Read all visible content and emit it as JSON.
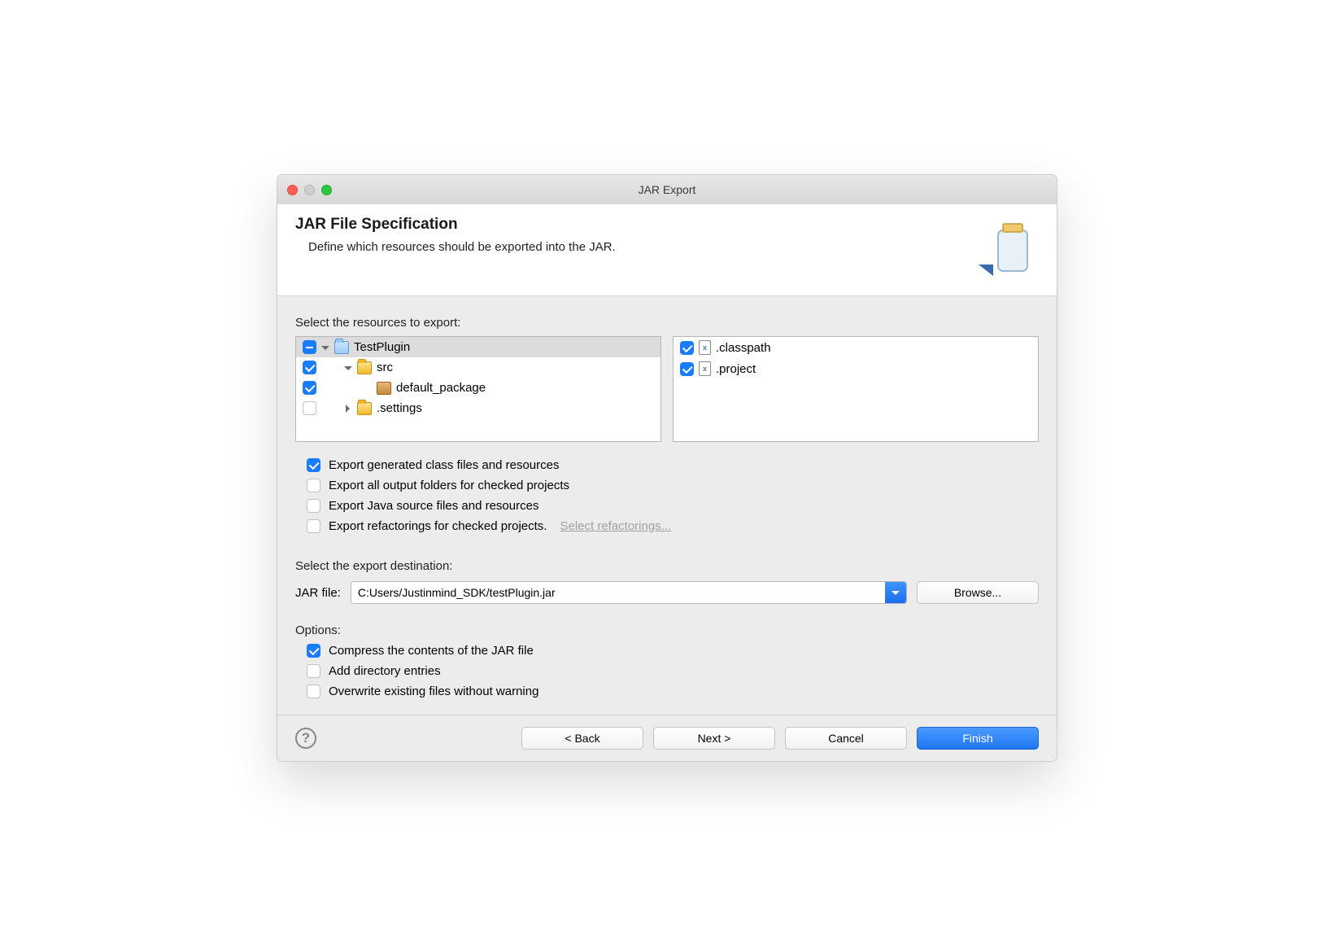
{
  "window": {
    "title": "JAR Export"
  },
  "header": {
    "title": "JAR File Specification",
    "subtitle": "Define which resources should be exported into the JAR."
  },
  "resources": {
    "label": "Select the resources to export:",
    "tree": [
      {
        "name": "TestPlugin",
        "state": "mixed",
        "expand": "down",
        "icon": "proj"
      },
      {
        "name": "src",
        "state": "checked",
        "expand": "down",
        "icon": "folder",
        "indent": 1
      },
      {
        "name": "default_package",
        "state": "checked",
        "icon": "pkg",
        "indent": 2
      },
      {
        "name": ".settings",
        "state": "unchecked",
        "expand": "right",
        "icon": "folder",
        "indent": 1
      }
    ],
    "files": [
      {
        "name": ".classpath",
        "state": "checked"
      },
      {
        "name": ".project",
        "state": "checked"
      }
    ]
  },
  "exportOptions": {
    "generated": {
      "label": "Export generated class files and resources",
      "checked": true
    },
    "outputFolders": {
      "label": "Export all output folders for checked projects",
      "checked": false
    },
    "javaSource": {
      "label": "Export Java source files and resources",
      "checked": false
    },
    "refactorings": {
      "label": "Export refactorings for checked projects.",
      "checked": false,
      "link": "Select refactorings..."
    }
  },
  "destination": {
    "label": "Select the export destination:",
    "fieldLabel": "JAR file:",
    "value": "C:Users/Justinmind_SDK/testPlugin.jar",
    "browse": "Browse..."
  },
  "options": {
    "label": "Options:",
    "compress": {
      "label": "Compress the contents of the JAR file",
      "checked": true
    },
    "dirEntries": {
      "label": "Add directory entries",
      "checked": false
    },
    "overwrite": {
      "label": "Overwrite existing files without warning",
      "checked": false
    }
  },
  "footer": {
    "back": "< Back",
    "next": "Next >",
    "cancel": "Cancel",
    "finish": "Finish"
  }
}
